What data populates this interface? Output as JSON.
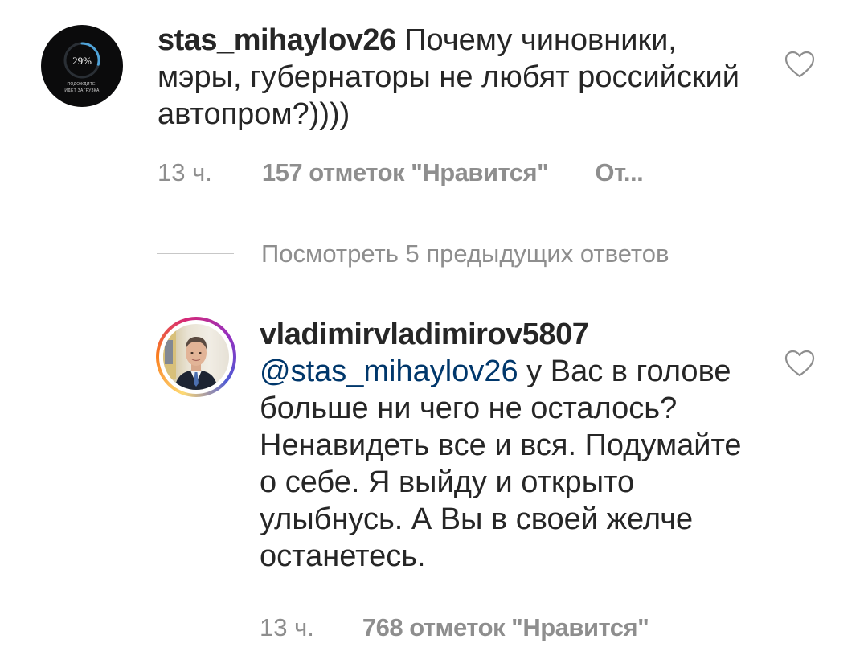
{
  "comments": [
    {
      "username": "stas_mihaylov26",
      "text": " Почему чиновники, мэры, губернаторы не любят российский автопром?))))",
      "time": "13 ч.",
      "likes": "157 отметок \"Нравится\"",
      "reply": "От...",
      "avatar": {
        "percent": "29%",
        "caption_line1": "ПОДОЖДИТЕ,",
        "caption_line2": "ИДЕТ ЗАГРУЗКА",
        "progress": 0.29
      },
      "icon": "heart-outline-icon"
    },
    {
      "username": "vladimirvladimirov5807",
      "mention": "@stas_mihaylov26",
      "text": " у Вас в голове больше ни чего не осталось? Ненавидеть все и вся. Подумайте о себе. Я выйду и открыто улыбнусь. А Вы в своей желче останетесь.",
      "time": "13 ч.",
      "likes": "768 отметок \"Нравится\"",
      "avatar": {
        "story_ring": true
      },
      "icon": "heart-outline-icon"
    }
  ],
  "view_previous": {
    "label": "Посмотреть 5 предыдущих ответов"
  },
  "colors": {
    "text": "#262626",
    "secondary": "#8e8e8e",
    "mention": "#00376b",
    "divider": "#c7c7c7",
    "progress_ring": "#4fa3d9"
  }
}
